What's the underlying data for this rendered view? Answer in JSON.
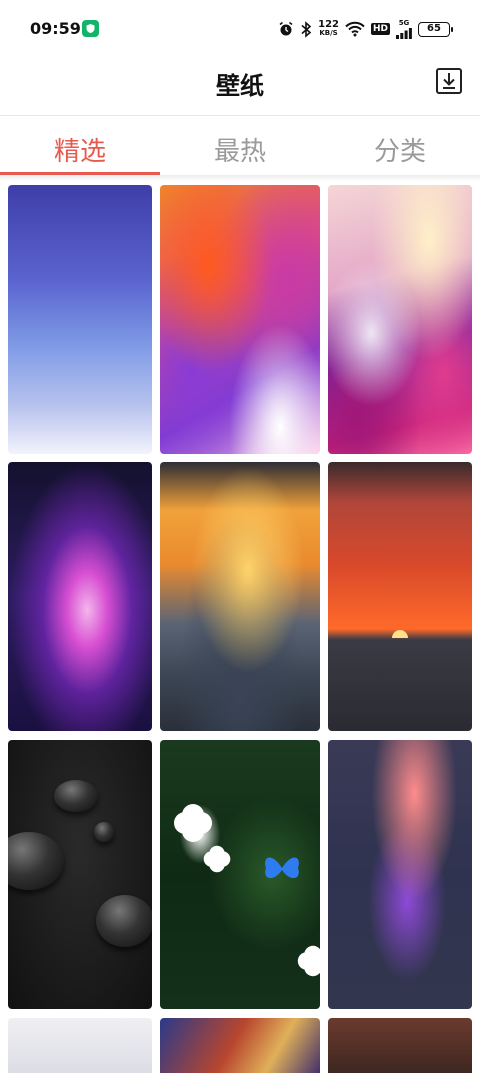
{
  "status_bar": {
    "time": "09:59",
    "net_speed_value": "122",
    "net_speed_unit": "KB/S",
    "hd_label": "HD",
    "network_type": "5G",
    "battery": "65"
  },
  "header": {
    "title": "壁纸"
  },
  "tabs": [
    {
      "label": "精选",
      "active": true
    },
    {
      "label": "最热",
      "active": false
    },
    {
      "label": "分类",
      "active": false
    }
  ],
  "colors": {
    "accent": "#e85a4f",
    "inactive_tab": "#9a9a9a"
  },
  "wallpapers": [
    {
      "theme": "blue-gradient"
    },
    {
      "theme": "orange-purple-fluid"
    },
    {
      "theme": "pink-purple-fluid"
    },
    {
      "theme": "purple-nebula"
    },
    {
      "theme": "sunset-clouds"
    },
    {
      "theme": "red-sunset-sea"
    },
    {
      "theme": "black-water-drops"
    },
    {
      "theme": "tropical-flowers-butterfly"
    },
    {
      "theme": "exotic-flowers"
    },
    {
      "theme": "light-gray"
    },
    {
      "theme": "colorful-swirl"
    },
    {
      "theme": "dark-brown"
    }
  ]
}
